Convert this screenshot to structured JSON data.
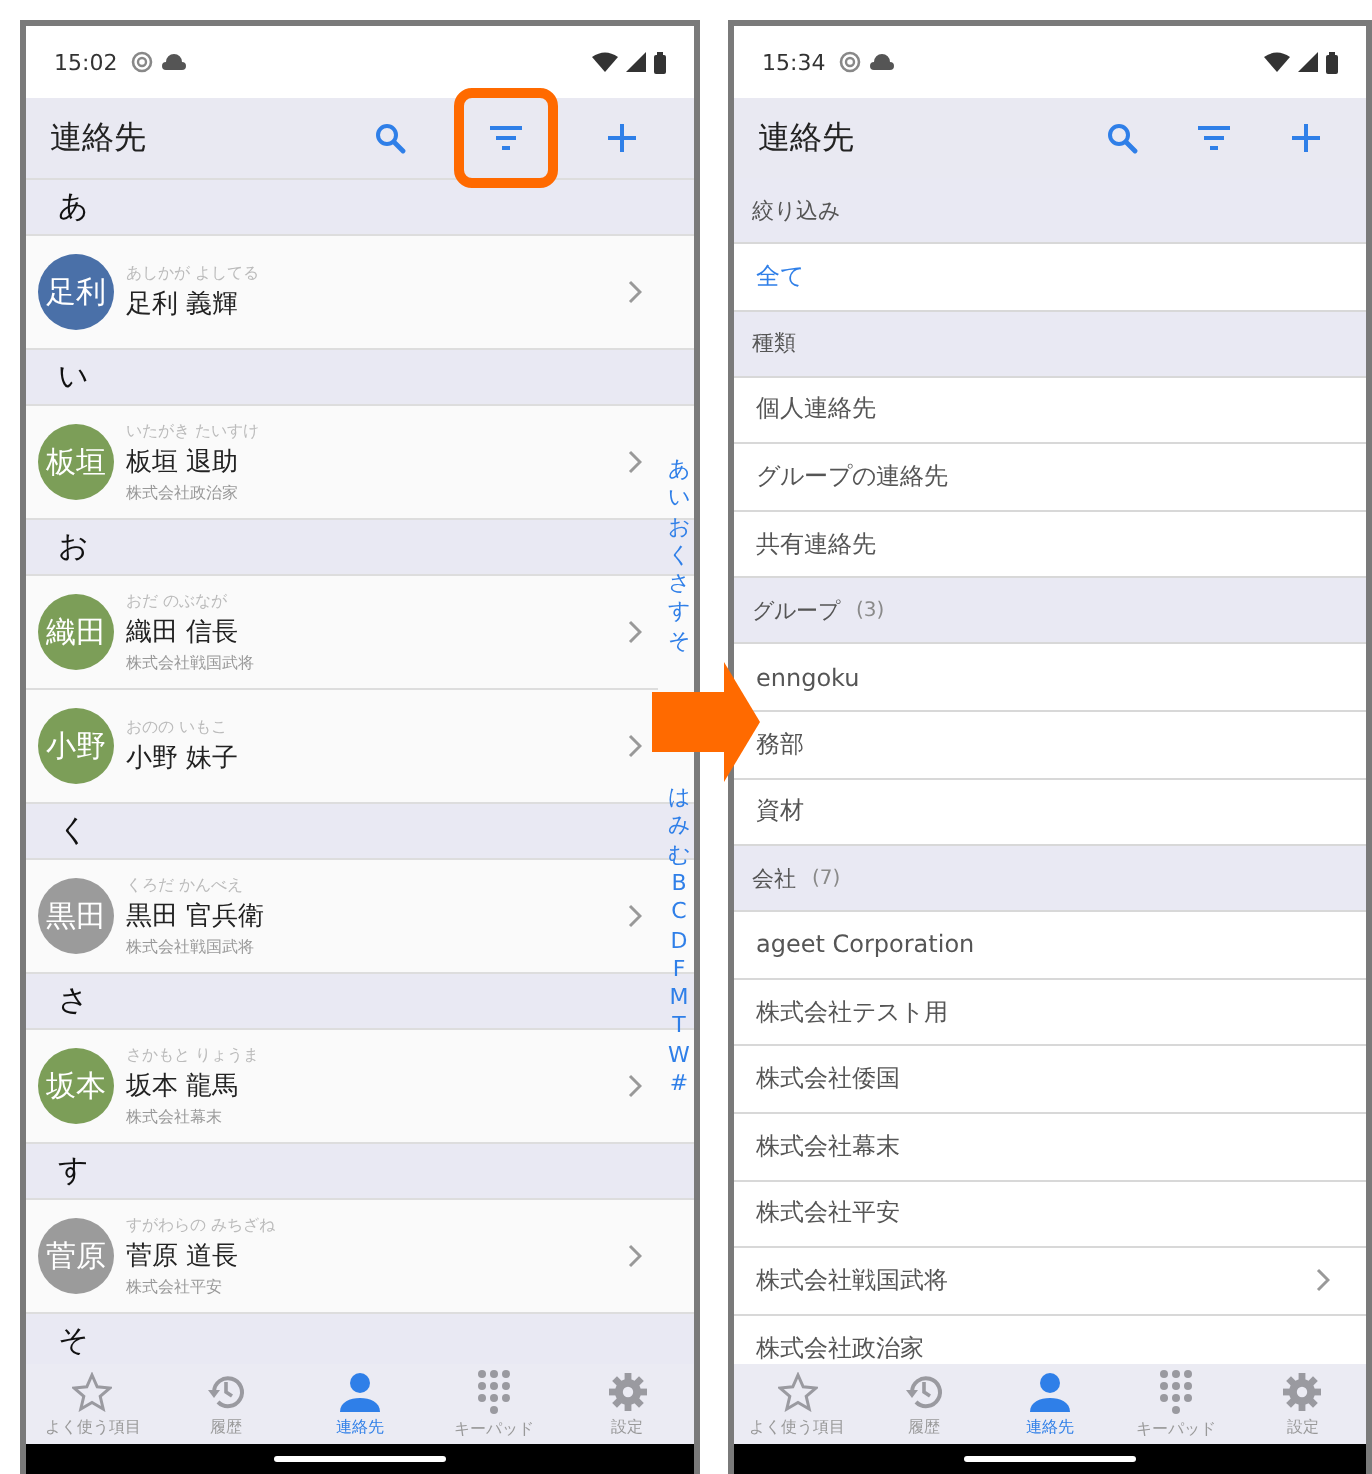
{
  "screens": [
    {
      "kind": "contacts",
      "status_bar": {
        "time": "15:02"
      },
      "header": {
        "title": "連絡先",
        "filter_highlighted": true
      },
      "sections": [
        {
          "letter": "あ",
          "contacts": [
            {
              "avatar": "足利",
              "color": "#4a70a8",
              "reading": "あしかが よしてる",
              "name": "足利 義輝"
            }
          ]
        },
        {
          "letter": "い",
          "contacts": [
            {
              "avatar": "板垣",
              "color": "#7c9e58",
              "reading": "いたがき たいすけ",
              "name": "板垣 退助",
              "company": "株式会社政治家"
            }
          ]
        },
        {
          "letter": "お",
          "contacts": [
            {
              "avatar": "織田",
              "color": "#7c9e58",
              "reading": "おだ のぶなが",
              "name": "織田 信長",
              "company": "株式会社戦国武将"
            },
            {
              "avatar": "小野",
              "color": "#7c9e58",
              "reading": "おのの いもこ",
              "name": "小野 妹子"
            }
          ]
        },
        {
          "letter": "く",
          "contacts": [
            {
              "avatar": "黒田",
              "color": "#9b9b9b",
              "reading": "くろだ かんべえ",
              "name": "黒田 官兵衛",
              "company": "株式会社戦国武将"
            }
          ]
        },
        {
          "letter": "さ",
          "contacts": [
            {
              "avatar": "坂本",
              "color": "#7c9e58",
              "reading": "さかもと りょうま",
              "name": "坂本 龍馬",
              "company": "株式会社幕末"
            }
          ]
        },
        {
          "letter": "す",
          "contacts": [
            {
              "avatar": "菅原",
              "color": "#9b9b9b",
              "reading": "すがわらの みちざね",
              "name": "菅原 道長",
              "company": "株式会社平安"
            }
          ]
        },
        {
          "letter": "そ"
        }
      ],
      "index_top": [
        "あ",
        "い",
        "お",
        "く",
        "さ",
        "す",
        "そ"
      ],
      "index_bottom": [
        "は",
        "み",
        "む",
        "B",
        "C",
        "D",
        "F",
        "M",
        "T",
        "W",
        "#"
      ],
      "tabs": [
        {
          "label": "よく使う項目",
          "selected": false
        },
        {
          "label": "履歴",
          "selected": false
        },
        {
          "label": "連絡先",
          "selected": true
        },
        {
          "label": "キーパッド",
          "selected": false
        },
        {
          "label": "設定",
          "selected": false
        }
      ]
    },
    {
      "kind": "filter",
      "status_bar": {
        "time": "15:34"
      },
      "header": {
        "title": "連絡先",
        "filter_highlighted": false
      },
      "groups": [
        {
          "title": "絞り込み",
          "items": [
            {
              "label": "全て",
              "selected": true,
              "expandable": false
            }
          ]
        },
        {
          "title": "種類",
          "items": [
            {
              "label": "個人連絡先",
              "selected": false,
              "expandable": false
            },
            {
              "label": "グループの連絡先",
              "selected": false,
              "expandable": false
            },
            {
              "label": "共有連絡先",
              "selected": false,
              "expandable": false
            }
          ]
        },
        {
          "title": "グループ",
          "count": "(3)",
          "items": [
            {
              "label": "enngoku",
              "selected": false,
              "expandable": false
            },
            {
              "label": "務部",
              "selected": false,
              "expandable": false
            },
            {
              "label": "資材",
              "selected": false,
              "expandable": false
            }
          ]
        },
        {
          "title": "会社",
          "count": "(7)",
          "items": [
            {
              "label": "ageet Corporation",
              "selected": false,
              "expandable": false
            },
            {
              "label": "株式会社テスト用",
              "selected": false,
              "expandable": false
            },
            {
              "label": "株式会社倭国",
              "selected": false,
              "expandable": false
            },
            {
              "label": "株式会社幕末",
              "selected": false,
              "expandable": false
            },
            {
              "label": "株式会社平安",
              "selected": false,
              "expandable": false
            },
            {
              "label": "株式会社戦国武将",
              "selected": false,
              "expandable": true
            },
            {
              "label": "株式会社政治家",
              "selected": false,
              "expandable": false
            }
          ]
        }
      ],
      "tabs": [
        {
          "label": "よく使う項目",
          "selected": false
        },
        {
          "label": "履歴",
          "selected": false
        },
        {
          "label": "連絡先",
          "selected": true
        },
        {
          "label": "キーパッド",
          "selected": false
        },
        {
          "label": "設定",
          "selected": false
        }
      ]
    }
  ]
}
